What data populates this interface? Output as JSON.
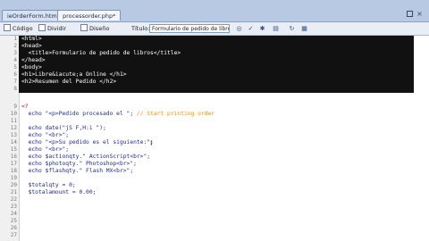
{
  "tabs": [
    {
      "label": "ieOrderForm.htm"
    },
    {
      "label": "processorder.php*"
    }
  ],
  "toolbar": {
    "code_label": "Código",
    "split_label": "Dividir",
    "design_label": "Diseño",
    "title_label": "Título:",
    "title_value": "Formulario de pedido de libros"
  },
  "editor": {
    "line_numbers": [
      "1",
      "2",
      "3",
      "4",
      "5",
      "6",
      "7",
      "8",
      "9",
      "10",
      "11",
      "12",
      "13",
      "14",
      "15",
      "16",
      "17",
      "18",
      "19",
      "20",
      "21",
      "22",
      "23",
      "24",
      "25",
      "26",
      "27"
    ],
    "lines": {
      "l1": "<html>",
      "l2": "<head>",
      "l3": "  <title>Formulario de pedido de libros</title>",
      "l4": "</head>",
      "l5": "<body>",
      "l6": "<h1>Libre&iacute;a Online </h1>",
      "l7": "<h2>Resumen del Pedido </h2>",
      "l8": "",
      "l9": "<?",
      "l10a": "  echo \"<p>Pedido procesado el \"; ",
      "l10b": "// Start printing order",
      "l11": "",
      "l12": "  echo date(\"jS F,H:i \");",
      "l13": "  echo \"<br>\";",
      "l14": "  echo \"<p>Su pedido es el siguiente:\";",
      "l15": "  echo \"<br>\";",
      "l16": "  echo $actionqty.\" ActionScript<br>\";",
      "l17": "  echo $photoqty.\" Photoshop<br>\";",
      "l18": "  echo $flashqty.\" Flash MX<br>\";",
      "l19": "",
      "l20": "  $totalqty = 0;",
      "l21": "  $totalamount = 0.00;"
    }
  },
  "colors": {
    "php_tag": "#c4000a",
    "text": "#1f2b8c",
    "comment": "#ff8c00",
    "selection": "#111111"
  },
  "icons": [
    "code-view-icon",
    "split-view-icon",
    "design-view-icon",
    "validate-icon",
    "browser-icon",
    "refresh-icon",
    "options-icon"
  ]
}
